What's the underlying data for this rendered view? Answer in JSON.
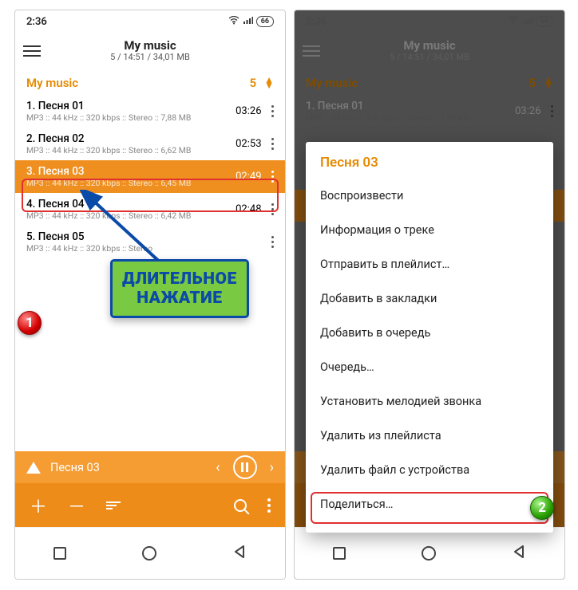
{
  "status": {
    "time": "2:36",
    "battery": "66"
  },
  "appbar": {
    "title": "My music",
    "sub": "5 / 14:51 / 34,01 MB"
  },
  "section": {
    "name": "My music",
    "count": "5"
  },
  "tracks": [
    {
      "title": "1. Песня 01",
      "meta": "MP3 :: 44 kHz :: 320 kbps :: Stereo :: 7,88 MB",
      "time": "03:26"
    },
    {
      "title": "2. Песня 02",
      "meta": "MP3 :: 44 kHz :: 320 kbps :: Stereo :: 6,62 MB",
      "time": "02:53"
    },
    {
      "title": "3. Песня 03",
      "meta": "MP3 :: 44 kHz :: 320 kbps :: Stereo :: 6,45 MB",
      "time": "02:49"
    },
    {
      "title": "4. Песня 04",
      "meta": "MP3 :: 44 kHz :: 320 kbps :: Stereo :: 6,42 MB",
      "time": "02:48"
    },
    {
      "title": "5. Песня 05",
      "meta": "MP3 :: 44 kHz :: 320 kbps :: Stereo",
      "time": ""
    }
  ],
  "nowplaying": {
    "title": "Песня 03"
  },
  "callout": {
    "line1": "ДЛИТЕЛЬНОЕ",
    "line2": "НАЖАТИЕ"
  },
  "badges": {
    "one": "1",
    "two": "2"
  },
  "menu": {
    "title": "Песня 03",
    "items": [
      "Воспроизвести",
      "Информация о треке",
      "Отправить в плейлист…",
      "Добавить в закладки",
      "Добавить в очередь",
      "Очередь…",
      "Установить мелодией звонка",
      "Удалить из плейлиста",
      "Удалить файл с устройства",
      "Поделиться…"
    ]
  }
}
